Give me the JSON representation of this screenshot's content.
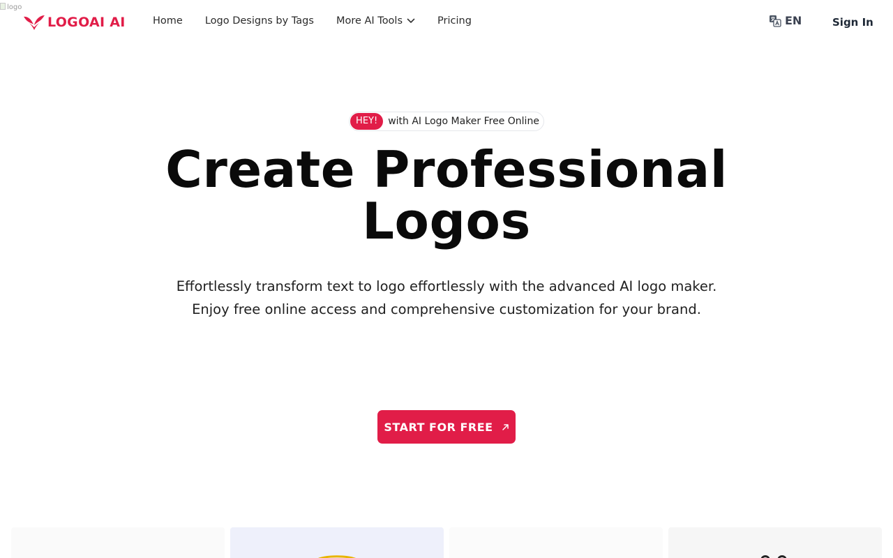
{
  "header": {
    "broken_image_alt": "logo",
    "brand_name": "LOGOAI AI",
    "nav": [
      {
        "label": "Home"
      },
      {
        "label": "Logo Designs by Tags"
      },
      {
        "label": "More AI Tools"
      },
      {
        "label": "Pricing"
      }
    ],
    "language": "EN",
    "sign_in": "Sign In"
  },
  "hero": {
    "badge_tag": "HEY!",
    "badge_text": "with AI Logo Maker Free Online",
    "headline_line1": "Create Professional",
    "headline_line2": "Logos",
    "subtitle": "Effortlessly transform text to logo effortlessly with the advanced AI logo maker. Enjoy free online access and comprehensive customization for your brand.",
    "cta_label": "START FOR FREE"
  },
  "icons": {
    "brand": "bird-logo-icon",
    "language": "translate-icon",
    "more_tools": "chevron-down-icon",
    "cta": "arrow-up-right-icon"
  },
  "colors": {
    "accent": "#e11d48",
    "text": "#111111",
    "background": "#ffffff"
  }
}
